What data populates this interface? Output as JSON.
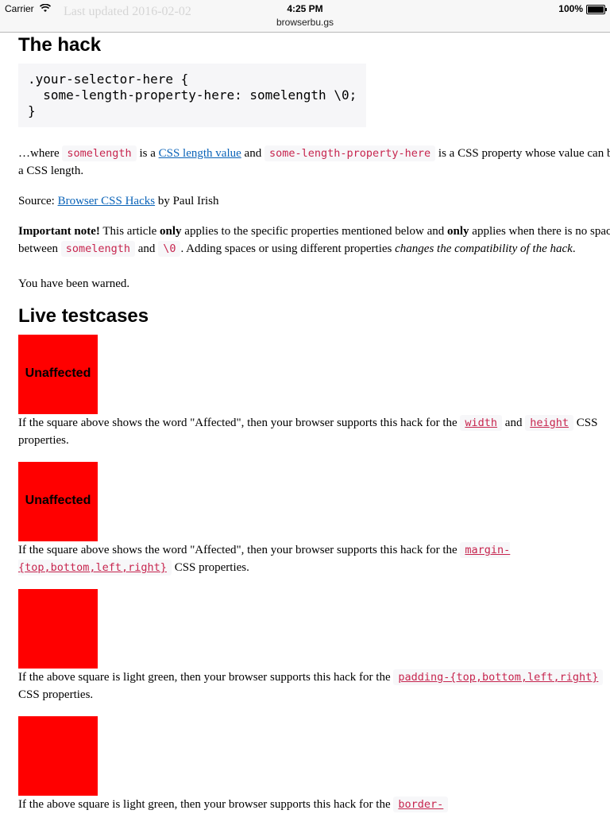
{
  "status_bar": {
    "carrier": "Carrier",
    "time": "4:25 PM",
    "url": "browserbu.gs",
    "battery": "100%",
    "ghost_text": "Last updated 2016-02-02"
  },
  "headings": {
    "hack": "The hack",
    "live": "Live testcases"
  },
  "code_block": {
    "line1": ".your-selector-here {",
    "line2": "  some-length-property-here: somelength \\0;",
    "line3": "}"
  },
  "para_where": {
    "prefix": "…where",
    "code1": "somelength",
    "text1": "is a",
    "link": "CSS length value",
    "text2": "and",
    "code2": "some-length-property-here",
    "text3": "is a CSS property whose value can be a CSS length."
  },
  "para_source": {
    "label": "Source:",
    "link": "Browser CSS Hacks",
    "suffix": "by Paul Irish"
  },
  "para_note": {
    "bold1": "Important note!",
    "t1": "This article",
    "bold2": "only",
    "t2": "applies to the specific properties mentioned below and",
    "bold3": "only",
    "t3": "applies when there is no space between",
    "code1": "somelength",
    "t4": "and",
    "code2": "\\0",
    "t5": ". Adding spaces or using different properties",
    "em": "changes the compatibility of the hack",
    "t6": "."
  },
  "para_warned": "You have been warned.",
  "testcases": [
    {
      "square_label": "Unaffected",
      "caption_prefix": "If the square above shows the word \"Affected\", then your browser supports this hack for the",
      "code_a": "width",
      "middle": "and",
      "code_b": "height",
      "suffix": "CSS properties."
    },
    {
      "square_label": "Unaffected",
      "caption_prefix": "If the square above shows the word \"Affected\", then your browser supports this hack for the",
      "code_a": "margin-{top,bottom,left,right}",
      "suffix": "CSS properties."
    },
    {
      "square_label": "",
      "caption_prefix": "If the above square is light green, then your browser supports this hack for the",
      "code_a": "padding-{top,bottom,left,right}",
      "suffix": "CSS properties."
    },
    {
      "square_label": "",
      "caption_prefix": "If the above square is light green, then your browser supports this hack for the",
      "code_a": "border-"
    }
  ],
  "colors": {
    "square": "#ff0000",
    "code_text": "#c7254e",
    "link": "#0a63b8"
  }
}
